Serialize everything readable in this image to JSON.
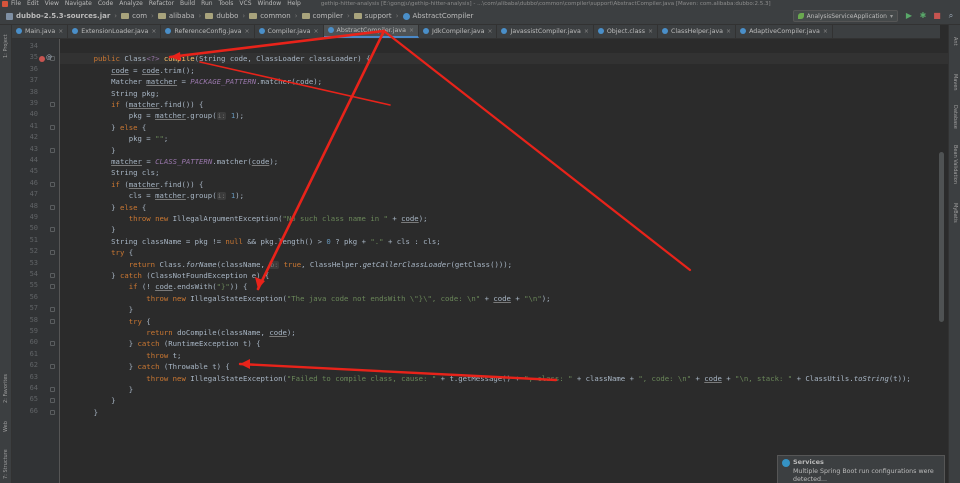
{
  "menu": {
    "items": [
      "File",
      "Edit",
      "View",
      "Navigate",
      "Code",
      "Analyze",
      "Refactor",
      "Build",
      "Run",
      "Tools",
      "VCS",
      "Window",
      "Help"
    ],
    "title_path": "gethip-hitter-analysis [E:\\gongju\\gethip-hitter-analysis] - ...\\com\\alibaba\\dubbo\\common\\compiler\\support\\AbstractCompiler.java [Maven: com.alibaba:dubbo:2.5.3]"
  },
  "breadcrumbs": [
    "dubbo-2.5.3-sources.jar",
    "com",
    "alibaba",
    "dubbo",
    "common",
    "compiler",
    "support",
    "AbstractCompiler"
  ],
  "toolbar": {
    "run_config": "AnalysisServiceApplication",
    "run_icon": "▶",
    "debug_icon": "✱",
    "stop_icon": "■",
    "search_icon": "⌕"
  },
  "tabs": [
    {
      "label": "Main.java",
      "color": "#4a8fc9",
      "active": false
    },
    {
      "label": "ExtensionLoader.java",
      "color": "#4a8fc9",
      "active": false
    },
    {
      "label": "ReferenceConfig.java",
      "color": "#4a8fc9",
      "active": false
    },
    {
      "label": "Compiler.java",
      "color": "#4a8fc9",
      "active": false
    },
    {
      "label": "AbstractCompiler.java",
      "color": "#4a8fc9",
      "active": true
    },
    {
      "label": "JdkCompiler.java",
      "color": "#4a8fc9",
      "active": false
    },
    {
      "label": "JavassistCompiler.java",
      "color": "#4a8fc9",
      "active": false
    },
    {
      "label": "Object.class",
      "color": "#4a8fc9",
      "active": false
    },
    {
      "label": "ClassHelper.java",
      "color": "#4a8fc9",
      "active": false
    },
    {
      "label": "AdaptiveCompiler.java",
      "color": "#4a8fc9",
      "active": false
    }
  ],
  "left_tools": [
    "1: Project",
    "2: Favorites",
    "7: Structure",
    "Web"
  ],
  "right_tools": [
    "Ant",
    "Maven",
    "Database",
    "Bean Validation",
    "MyBatis"
  ],
  "editor": {
    "line_numbers": [
      "34",
      "35",
      "36",
      "37",
      "38",
      "39",
      "40",
      "41",
      "42",
      "43",
      "44",
      "45",
      "46",
      "47",
      "48",
      "49",
      "50",
      "51",
      "52",
      "53",
      "54",
      "55",
      "56",
      "57",
      "58",
      "59",
      "60",
      "61",
      "62",
      "63",
      "64",
      "65",
      "66"
    ],
    "lines": [
      [],
      [
        {
          "t": "    "
        },
        {
          "t": "public ",
          "c": "keyword"
        },
        {
          "t": "Class"
        },
        {
          "t": "<?>",
          "c": "field"
        },
        {
          "t": " "
        },
        {
          "t": "compile",
          "c": "method"
        },
        {
          "t": "(String code, ClassLoader classLoader) {"
        }
      ],
      [
        {
          "t": "        "
        },
        {
          "t": "code",
          "c": "usage"
        },
        {
          "t": " = "
        },
        {
          "t": "code",
          "c": "usage"
        },
        {
          "t": ".trim();"
        }
      ],
      [
        {
          "t": "        Matcher "
        },
        {
          "t": "matcher",
          "c": "usage"
        },
        {
          "t": " = "
        },
        {
          "t": "PACKAGE_PATTERN",
          "c": "const"
        },
        {
          "t": ".matcher(code);"
        }
      ],
      [
        {
          "t": "        String pkg;"
        }
      ],
      [
        {
          "t": "        "
        },
        {
          "t": "if ",
          "c": "keyword"
        },
        {
          "t": "("
        },
        {
          "t": "matcher",
          "c": "usage"
        },
        {
          "t": ".find()) {"
        }
      ],
      [
        {
          "t": "            pkg = "
        },
        {
          "t": "matcher",
          "c": "usage"
        },
        {
          "t": ".group("
        },
        {
          "t": "i:",
          "c": "hint"
        },
        {
          "t": " "
        },
        {
          "t": "1",
          "c": "num"
        },
        {
          "t": ");"
        }
      ],
      [
        {
          "t": "        } "
        },
        {
          "t": "else ",
          "c": "keyword"
        },
        {
          "t": "{"
        }
      ],
      [
        {
          "t": "            pkg = "
        },
        {
          "t": "\"\"",
          "c": "string"
        },
        {
          "t": ";"
        }
      ],
      [
        {
          "t": "        }"
        }
      ],
      [
        {
          "t": "        "
        },
        {
          "t": "matcher",
          "c": "usage"
        },
        {
          "t": " = "
        },
        {
          "t": "CLASS_PATTERN",
          "c": "const"
        },
        {
          "t": ".matcher("
        },
        {
          "t": "code",
          "c": "usage"
        },
        {
          "t": ");"
        }
      ],
      [
        {
          "t": "        String cls;"
        }
      ],
      [
        {
          "t": "        "
        },
        {
          "t": "if ",
          "c": "keyword"
        },
        {
          "t": "("
        },
        {
          "t": "matcher",
          "c": "usage"
        },
        {
          "t": ".find()) {"
        }
      ],
      [
        {
          "t": "            cls = "
        },
        {
          "t": "matcher",
          "c": "usage"
        },
        {
          "t": ".group("
        },
        {
          "t": "i:",
          "c": "hint"
        },
        {
          "t": " "
        },
        {
          "t": "1",
          "c": "num"
        },
        {
          "t": ");"
        }
      ],
      [
        {
          "t": "        } "
        },
        {
          "t": "else ",
          "c": "keyword"
        },
        {
          "t": "{"
        }
      ],
      [
        {
          "t": "            "
        },
        {
          "t": "throw new ",
          "c": "keyword"
        },
        {
          "t": "IllegalArgumentException("
        },
        {
          "t": "\"No such class name in \"",
          "c": "string"
        },
        {
          "t": " + "
        },
        {
          "t": "code",
          "c": "usage"
        },
        {
          "t": ");"
        }
      ],
      [
        {
          "t": "        }"
        }
      ],
      [
        {
          "t": "        String className = pkg != "
        },
        {
          "t": "null ",
          "c": "keyword"
        },
        {
          "t": "&& pkg.length() > "
        },
        {
          "t": "0",
          "c": "num"
        },
        {
          "t": " ? pkg + "
        },
        {
          "t": "\".\"",
          "c": "string"
        },
        {
          "t": " + cls : cls;"
        }
      ],
      [
        {
          "t": "        "
        },
        {
          "t": "try ",
          "c": "keyword"
        },
        {
          "t": "{"
        }
      ],
      [
        {
          "t": "            "
        },
        {
          "t": "return ",
          "c": "keyword"
        },
        {
          "t": "Class."
        },
        {
          "t": "forName",
          "c": "italic"
        },
        {
          "t": "(className, "
        },
        {
          "t": "b:",
          "c": "hint"
        },
        {
          "t": " "
        },
        {
          "t": "true",
          "c": "keyword"
        },
        {
          "t": ", ClassHelper."
        },
        {
          "t": "getCallerClassLoader",
          "c": "italic"
        },
        {
          "t": "(getClass()));"
        }
      ],
      [
        {
          "t": "        } "
        },
        {
          "t": "catch ",
          "c": "keyword"
        },
        {
          "t": "(ClassNotFoundException e) {"
        }
      ],
      [
        {
          "t": "            "
        },
        {
          "t": "if ",
          "c": "keyword"
        },
        {
          "t": "(! "
        },
        {
          "t": "code",
          "c": "usage"
        },
        {
          "t": ".endsWith("
        },
        {
          "t": "\"}\"",
          "c": "string"
        },
        {
          "t": ")) {"
        }
      ],
      [
        {
          "t": "                "
        },
        {
          "t": "throw new ",
          "c": "keyword"
        },
        {
          "t": "IllegalStateException("
        },
        {
          "t": "\"The java code not endsWith \\\"}\\\", code: \\n\"",
          "c": "string"
        },
        {
          "t": " + "
        },
        {
          "t": "code",
          "c": "usage"
        },
        {
          "t": " + "
        },
        {
          "t": "\"\\n\"",
          "c": "string"
        },
        {
          "t": ");"
        }
      ],
      [
        {
          "t": "            }"
        }
      ],
      [
        {
          "t": "            "
        },
        {
          "t": "try ",
          "c": "keyword"
        },
        {
          "t": "{"
        }
      ],
      [
        {
          "t": "                "
        },
        {
          "t": "return ",
          "c": "keyword"
        },
        {
          "t": "doCompile(className, "
        },
        {
          "t": "code",
          "c": "usage"
        },
        {
          "t": ");"
        }
      ],
      [
        {
          "t": "            } "
        },
        {
          "t": "catch ",
          "c": "keyword"
        },
        {
          "t": "(RuntimeException t) {"
        }
      ],
      [
        {
          "t": "                "
        },
        {
          "t": "throw ",
          "c": "keyword"
        },
        {
          "t": "t;"
        }
      ],
      [
        {
          "t": "            } "
        },
        {
          "t": "catch ",
          "c": "keyword"
        },
        {
          "t": "(Throwable t) {"
        }
      ],
      [
        {
          "t": "                "
        },
        {
          "t": "throw new ",
          "c": "keyword"
        },
        {
          "t": "IllegalStateException("
        },
        {
          "t": "\"Failed to compile class, cause: \"",
          "c": "string"
        },
        {
          "t": " + t.getMessage() + "
        },
        {
          "t": "\", class: \"",
          "c": "string"
        },
        {
          "t": " + className + "
        },
        {
          "t": "\", code: \\n\"",
          "c": "string"
        },
        {
          "t": " + "
        },
        {
          "t": "code",
          "c": "usage"
        },
        {
          "t": " + "
        },
        {
          "t": "\"\\n, stack: \"",
          "c": "string"
        },
        {
          "t": " + ClassUtils."
        },
        {
          "t": "toString",
          "c": "italic"
        },
        {
          "t": "(t));"
        }
      ],
      [
        {
          "t": "            }"
        }
      ],
      [
        {
          "t": "        }"
        }
      ],
      [
        {
          "t": "    }"
        }
      ]
    ]
  },
  "notification": {
    "title": "Services",
    "body": "Multiple Spring Boot run configurations were detected..."
  },
  "colors": {
    "editor_bg": "#2b2b2b",
    "gutter_bg": "#313335",
    "keyword": "#cc7832",
    "string": "#6a8759",
    "constant": "#9876aa",
    "annotation_arrow": "#e8231a"
  }
}
